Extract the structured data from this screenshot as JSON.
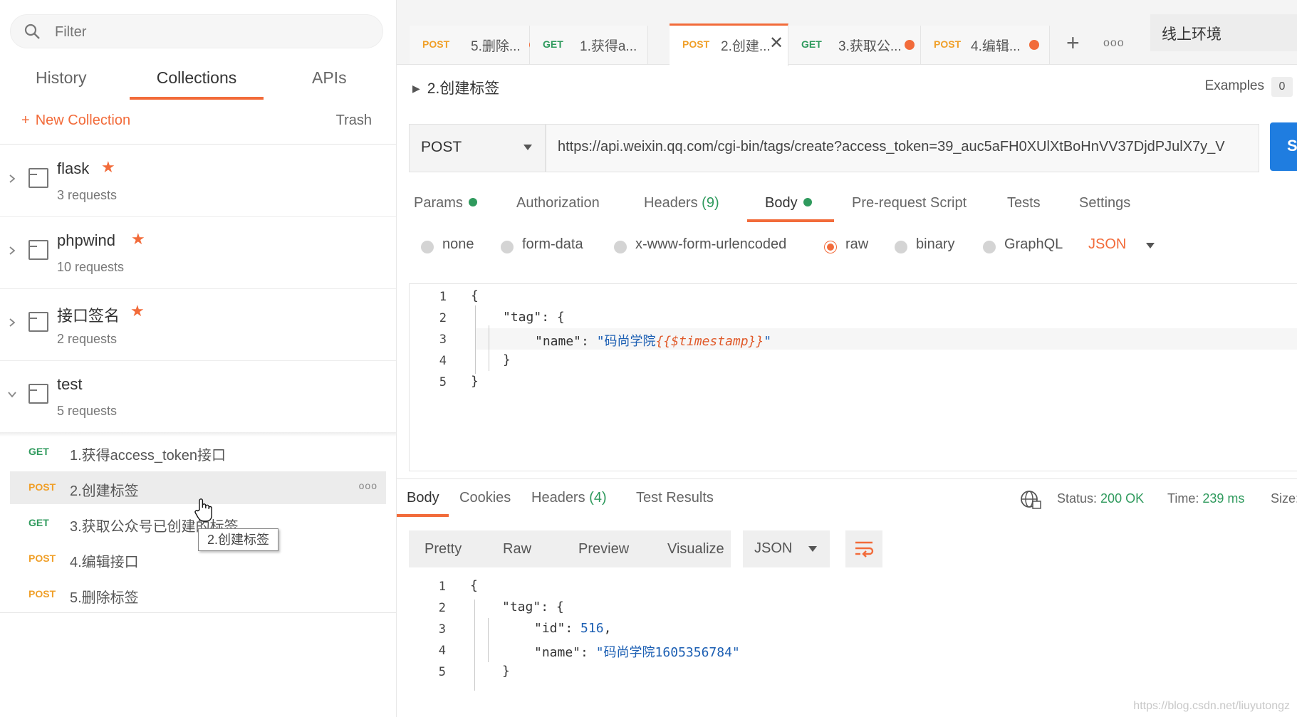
{
  "sidebar": {
    "filter_placeholder": "Filter",
    "tabs": [
      "History",
      "Collections",
      "APIs"
    ],
    "new_collection": "New Collection",
    "trash": "Trash",
    "collections": [
      {
        "name": "flask",
        "count": "3 requests",
        "starred": true
      },
      {
        "name": "phpwind",
        "count": "10 requests",
        "starred": true
      },
      {
        "name": "接口签名",
        "count": "2 requests",
        "starred": true
      },
      {
        "name": "test",
        "count": "5 requests",
        "starred": false
      }
    ],
    "requests": [
      {
        "method": "GET",
        "title": "1.获得access_token接口"
      },
      {
        "method": "POST",
        "title": "2.创建标签"
      },
      {
        "method": "GET",
        "title": "3.获取公众号已创建的标签"
      },
      {
        "method": "POST",
        "title": "4.编辑接口"
      },
      {
        "method": "POST",
        "title": "5.删除标签"
      }
    ],
    "tooltip": "2.创建标签"
  },
  "tabs": [
    {
      "method": "POST",
      "title": "5.删除..."
    },
    {
      "method": "GET",
      "title": "1.获得a..."
    },
    {
      "method": "POST",
      "title": "2.创建..."
    },
    {
      "method": "GET",
      "title": "3.获取公..."
    },
    {
      "method": "POST",
      "title": "4.编辑..."
    }
  ],
  "environment": "线上环境",
  "request": {
    "breadcrumb": "2.创建标签",
    "examples_label": "Examples",
    "examples_count": "0",
    "method": "POST",
    "url": "https://api.weixin.qq.com/cgi-bin/tags/create?access_token=39_auc5aFH0XUlXtBoHnVV37DjdPJulX7y_V",
    "send_label": "S",
    "tabs": {
      "params": "Params",
      "authorization": "Authorization",
      "headers": "Headers",
      "headers_count": "(9)",
      "body": "Body",
      "pre_request": "Pre-request Script",
      "tests": "Tests",
      "settings": "Settings"
    },
    "body_types": [
      "none",
      "form-data",
      "x-www-form-urlencoded",
      "raw",
      "binary",
      "GraphQL"
    ],
    "body_format": "JSON",
    "body_lines": {
      "l1": "{",
      "l2_key": "\"tag\"",
      "l2_rest": ": {",
      "l3_key": "\"name\"",
      "l3_colon": ": ",
      "l3_str": "\"码尚学院",
      "l3_var": "{{$timestamp}}",
      "l3_end": "\"",
      "l4": "}",
      "l5": "}"
    }
  },
  "response": {
    "tabs": {
      "body": "Body",
      "cookies": "Cookies",
      "headers": "Headers",
      "headers_count": "(4)",
      "test_results": "Test Results"
    },
    "status_label": "Status:",
    "status_value": "200 OK",
    "time_label": "Time:",
    "time_value": "239 ms",
    "size_label": "Size:",
    "views": [
      "Pretty",
      "Raw",
      "Preview",
      "Visualize"
    ],
    "format": "JSON",
    "lines": {
      "l1": "{",
      "l2_key": "\"tag\"",
      "l2_rest": ": {",
      "l3_key": "\"id\"",
      "l3_rest": ": ",
      "l3_num": "516",
      "l3_comma": ",",
      "l4_key": "\"name\"",
      "l4_rest": ": ",
      "l4_str": "\"码尚学院1605356784\"",
      "l5": "}"
    }
  },
  "watermark": "https://blog.csdn.net/liuyutongz",
  "colors": {
    "accent": "#f26b3a",
    "get": "#2f9a5d",
    "post": "#f0a02a",
    "send": "#1f7de0"
  }
}
